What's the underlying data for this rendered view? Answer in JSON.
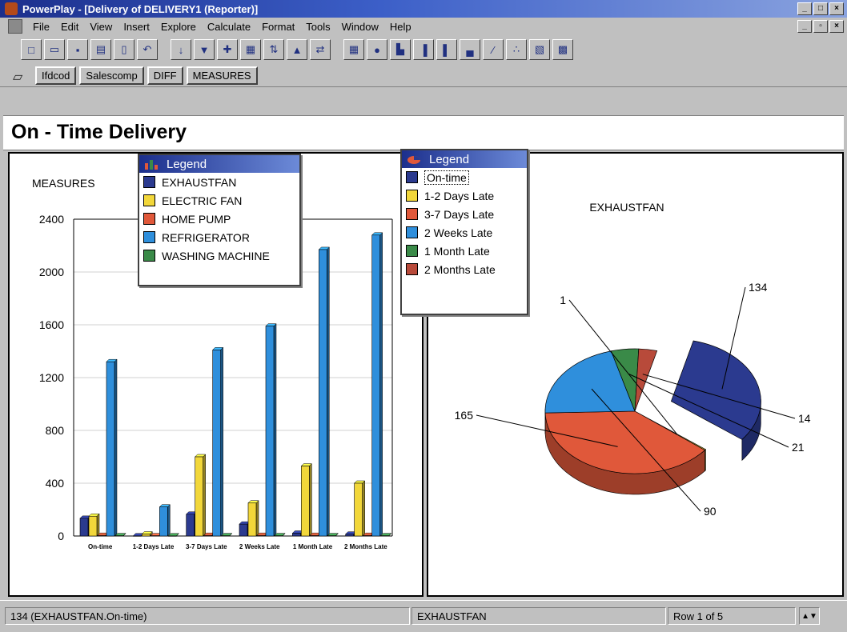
{
  "window": {
    "title": "PowerPlay - [Delivery of DELIVERY1 (Reporter)]"
  },
  "menu": [
    "File",
    "Edit",
    "View",
    "Insert",
    "Explore",
    "Calculate",
    "Format",
    "Tools",
    "Window",
    "Help"
  ],
  "toolbar_icons": [
    "new-icon",
    "open-icon",
    "save-icon",
    "print-icon",
    "preview-icon",
    "undo-icon",
    "drill-icon",
    "filter-icon",
    "explore-icon",
    "rank-icon",
    "sort-icon",
    "chart-icon",
    "swap-icon",
    "crosstab-icon",
    "pie-icon",
    "3d-bar-icon",
    "bar-icon",
    "clustered-bar-icon",
    "stacked-bar-icon",
    "line-icon",
    "scatter-icon",
    "correlation-icon",
    "multiline-icon"
  ],
  "dimension_bar": [
    "Ifdcod",
    "Salescomp",
    "DIFF",
    "MEASURES"
  ],
  "report": {
    "title": "On - Time Delivery"
  },
  "bar_legend": {
    "title": "Legend",
    "items": [
      {
        "label": "EXHAUSTFAN",
        "color": "#2b3a8f"
      },
      {
        "label": "ELECTRIC FAN",
        "color": "#f2d73a"
      },
      {
        "label": "HOME PUMP",
        "color": "#e0583a"
      },
      {
        "label": "REFRIGERATOR",
        "color": "#2f8fdc"
      },
      {
        "label": "WASHING MACHINE",
        "color": "#3a8a48"
      }
    ]
  },
  "pie_legend": {
    "title": "Legend",
    "items": [
      {
        "label": "On-time",
        "color": "#2b3a8f"
      },
      {
        "label": "1-2 Days Late",
        "color": "#f2d73a"
      },
      {
        "label": "3-7 Days Late",
        "color": "#e0583a"
      },
      {
        "label": "2 Weeks Late",
        "color": "#2f8fdc"
      },
      {
        "label": "1 Month Late",
        "color": "#3a8a48"
      },
      {
        "label": "2 Months Late",
        "color": "#b84a3a"
      }
    ]
  },
  "chart_data": [
    {
      "type": "bar",
      "ylabel": "MEASURES",
      "ylim": [
        0,
        2400
      ],
      "yticks": [
        0,
        400,
        800,
        1200,
        1600,
        2000,
        2400
      ],
      "categories": [
        "On-time",
        "1-2 Days Late",
        "3-7 Days Late",
        "2 Weeks Late",
        "1 Month Late",
        "2 Months Late"
      ],
      "series": [
        {
          "name": "EXHAUSTFAN",
          "color": "#2b3a8f",
          "values": [
            134,
            1,
            165,
            90,
            21,
            14
          ]
        },
        {
          "name": "ELECTRIC FAN",
          "color": "#f2d73a",
          "values": [
            150,
            15,
            600,
            250,
            530,
            400
          ]
        },
        {
          "name": "HOME PUMP",
          "color": "#e0583a",
          "values": [
            5,
            2,
            5,
            5,
            5,
            5
          ]
        },
        {
          "name": "REFRIGERATOR",
          "color": "#2f8fdc",
          "values": [
            1320,
            220,
            1410,
            1590,
            2170,
            2280
          ]
        },
        {
          "name": "WASHING MACHINE",
          "color": "#3a8a48",
          "values": [
            2,
            1,
            2,
            2,
            2,
            2
          ]
        }
      ]
    },
    {
      "type": "pie",
      "title": "EXHAUSTFAN",
      "slices": [
        {
          "label": "On-time",
          "value": 134,
          "color": "#2b3a8f"
        },
        {
          "label": "1-2 Days Late",
          "value": 1,
          "color": "#f2d73a"
        },
        {
          "label": "3-7 Days Late",
          "value": 165,
          "color": "#e0583a"
        },
        {
          "label": "2 Weeks Late",
          "value": 90,
          "color": "#2f8fdc"
        },
        {
          "label": "1 Month Late",
          "value": 21,
          "color": "#3a8a48"
        },
        {
          "label": "2 Months Late",
          "value": 14,
          "color": "#b84a3a"
        }
      ]
    }
  ],
  "status": {
    "cell": "134  (EXHAUSTFAN.On-time)",
    "dimension": "EXHAUSTFAN",
    "row": "Row 1 of 5"
  }
}
